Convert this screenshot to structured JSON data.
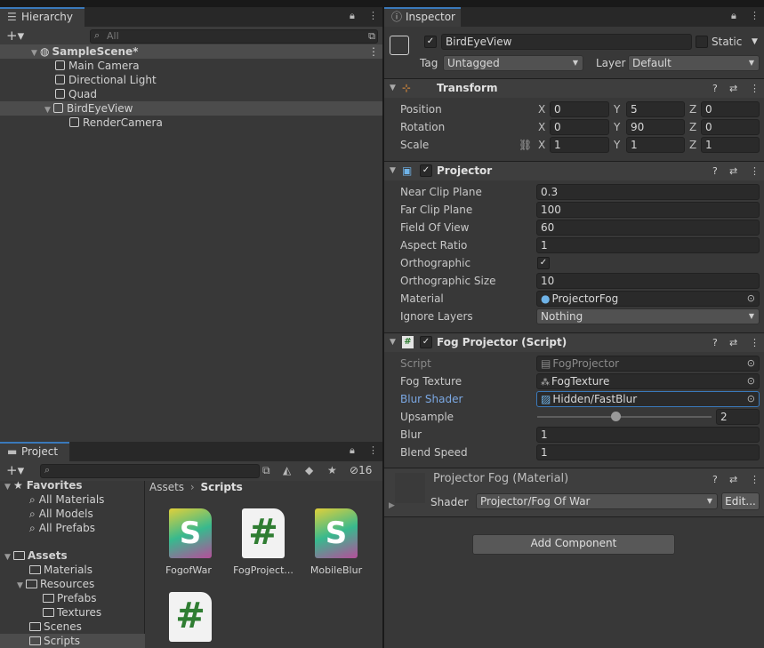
{
  "hierarchy": {
    "tab_label": "Hierarchy",
    "search_placeholder": "All",
    "items": [
      "SampleScene*",
      "Main Camera",
      "Directional Light",
      "Quad",
      "BirdEyeView",
      "RenderCamera"
    ]
  },
  "project": {
    "tab_label": "Project",
    "hidden_count": "16",
    "favorites_label": "Favorites",
    "favorites": [
      "All Materials",
      "All Models",
      "All Prefabs"
    ],
    "assets_label": "Assets",
    "tree": [
      "Materials",
      "Resources",
      "Prefabs",
      "Textures",
      "Scenes",
      "Scripts"
    ],
    "breadcrumb": [
      "Assets",
      "Scripts"
    ],
    "files": [
      {
        "name": "FogofWar",
        "icon": "S"
      },
      {
        "name": "FogProject...",
        "icon": "#"
      },
      {
        "name": "MobileBlur",
        "icon": "S"
      },
      {
        "name": "",
        "icon": "#"
      }
    ]
  },
  "inspector": {
    "tab_label": "Inspector",
    "object_name": "BirdEyeView",
    "static_label": "Static",
    "tag_label": "Tag",
    "tag_value": "Untagged",
    "layer_label": "Layer",
    "layer_value": "Default",
    "transform": {
      "title": "Transform",
      "rows": [
        {
          "label": "Position",
          "x": "0",
          "y": "5",
          "z": "0"
        },
        {
          "label": "Rotation",
          "x": "0",
          "y": "90",
          "z": "0"
        },
        {
          "label": "Scale",
          "x": "1",
          "y": "1",
          "z": "1"
        }
      ]
    },
    "projector": {
      "title": "Projector",
      "near_label": "Near Clip Plane",
      "near": "0.3",
      "far_label": "Far Clip Plane",
      "far": "100",
      "fov_label": "Field Of View",
      "fov": "60",
      "aspect_label": "Aspect Ratio",
      "aspect": "1",
      "ortho_label": "Orthographic",
      "ortho_size_label": "Orthographic Size",
      "ortho_size": "10",
      "material_label": "Material",
      "material": "ProjectorFog",
      "ignore_label": "Ignore Layers",
      "ignore": "Nothing"
    },
    "fog": {
      "title": "Fog Projector (Script)",
      "script_label": "Script",
      "script": "FogProjector",
      "texture_label": "Fog Texture",
      "texture": "FogTexture",
      "shader_label": "Blur Shader",
      "shader": "Hidden/FastBlur",
      "upsample_label": "Upsample",
      "upsample": "2",
      "upsample_fraction": 0.45,
      "blur_label": "Blur",
      "blur": "1",
      "speed_label": "Blend Speed",
      "speed": "1"
    },
    "material": {
      "title": "Projector Fog (Material)",
      "shader_label": "Shader",
      "shader": "Projector/Fog Of War",
      "edit_label": "Edit..."
    },
    "add_component": "Add Component"
  },
  "colors": {
    "accent": "#3a79bb",
    "panel": "#383838",
    "selection": "#4c4c4c"
  }
}
